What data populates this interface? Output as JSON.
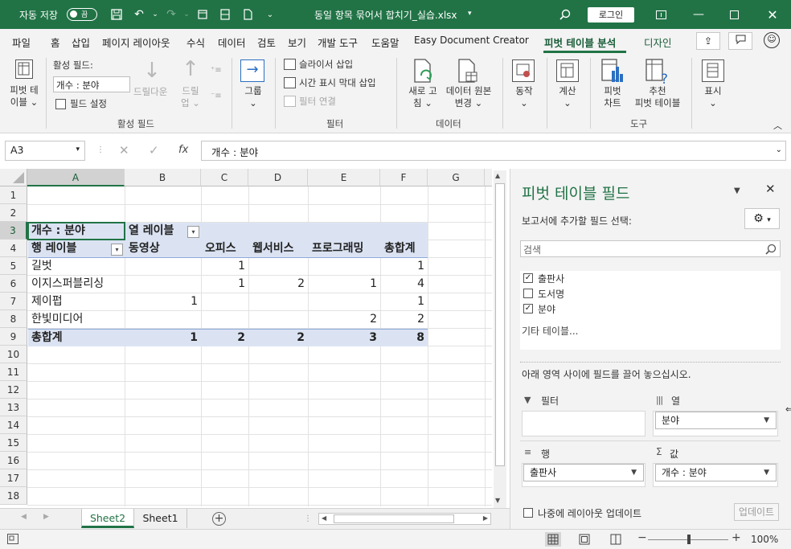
{
  "titlebar": {
    "autosave_label": "자동 저장",
    "toggle_state": "끔",
    "filename": "동일 항목 묶어서 합치기_실습.xlsx",
    "login": "로그인",
    "accent": "#217346"
  },
  "tabs": [
    "파일",
    "홈",
    "삽입",
    "페이지 레이아웃",
    "수식",
    "데이터",
    "검토",
    "보기",
    "개발 도구",
    "도움말",
    "Easy Document Creator",
    "피벗 테이블 분석",
    "디자인"
  ],
  "ribbon": {
    "pivot_table": [
      "피벗 테",
      "이블"
    ],
    "active_field_label": "활성 필드:",
    "active_field_value": "개수 : 분야",
    "field_settings": "필드 설정",
    "drill_down": "드릴다운",
    "drill_up": [
      "드릴",
      "업"
    ],
    "group": "그룹",
    "insert_slicer": "슬라이서 삽입",
    "insert_timeline": "시간 표시 막대 삽입",
    "filter_connections": "필터 연결",
    "refresh": [
      "새로 고",
      "침"
    ],
    "change_source": [
      "데이터 원본",
      "변경"
    ],
    "actions": "동작",
    "calculations": "계산",
    "pivot_chart": [
      "피벗",
      "차트"
    ],
    "recommended": [
      "추천",
      "피벗 테이블"
    ],
    "show": "표시",
    "groups": {
      "active_field": "활성 필드",
      "filter": "필터",
      "data": "데이터",
      "tools": "도구"
    }
  },
  "formula_bar": {
    "name_box": "A3",
    "formula": "개수 : 분야"
  },
  "grid": {
    "columns": [
      "A",
      "B",
      "C",
      "D",
      "E",
      "F",
      "G"
    ],
    "rows": [
      "1",
      "2",
      "3",
      "4",
      "5",
      "6",
      "7",
      "8",
      "9",
      "10",
      "11",
      "12",
      "13",
      "14",
      "15",
      "16",
      "17",
      "18"
    ],
    "pivot": {
      "count_label": "개수 : 분야",
      "col_labels": "열 레이블",
      "row_labels": "행 레이블",
      "headers": [
        "동영상",
        "오피스",
        "웹서비스",
        "프로그래밍",
        "총합계"
      ],
      "rows": [
        {
          "name": "길벗",
          "values": [
            "",
            "1",
            "",
            "",
            "1"
          ]
        },
        {
          "name": "이지스퍼블리싱",
          "values": [
            "",
            "1",
            "2",
            "1",
            "4"
          ]
        },
        {
          "name": "제이펍",
          "values": [
            "1",
            "",
            "",
            "",
            "1"
          ]
        },
        {
          "name": "한빛미디어",
          "values": [
            "",
            "",
            "",
            "2",
            "2"
          ]
        }
      ],
      "total": {
        "name": "총합계",
        "values": [
          "1",
          "2",
          "2",
          "3",
          "8"
        ]
      }
    }
  },
  "sheets": [
    "Sheet2",
    "Sheet1"
  ],
  "status": {
    "zoom": "100%"
  },
  "pane": {
    "title": "피벗 테이블 필드",
    "subtitle": "보고서에 추가할 필드 선택:",
    "search_placeholder": "검색",
    "fields": [
      {
        "name": "출판사",
        "checked": true
      },
      {
        "name": "도서명",
        "checked": false
      },
      {
        "name": "분야",
        "checked": true
      }
    ],
    "more_tables": "기타 테이블...",
    "drag_hint": "아래 영역 사이에 필드를 끌어 놓으십시오.",
    "filters_label": "필터",
    "columns_label": "열",
    "columns_value": "분야",
    "rows_label": "행",
    "rows_value": "출판사",
    "values_label": "값",
    "values_value": "개수 : 분야",
    "defer_label": "나중에 레이아웃 업데이트",
    "update_button": "업데이트"
  }
}
